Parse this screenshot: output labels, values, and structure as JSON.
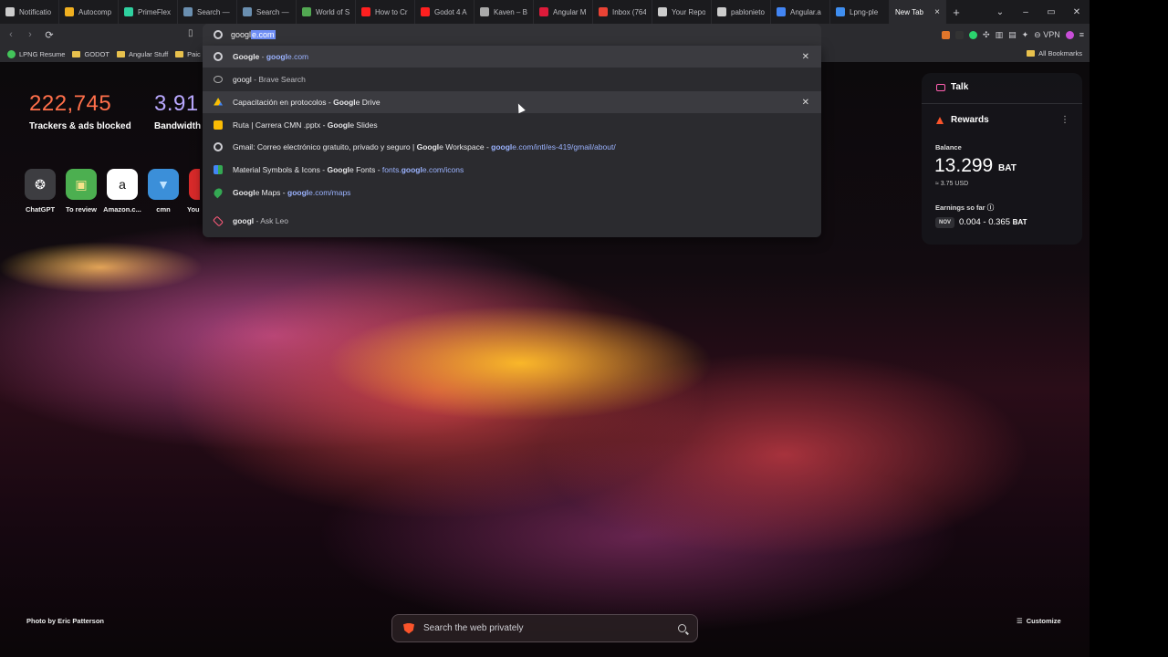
{
  "tabs": [
    {
      "label": "Notificatio",
      "color": "#cccccc"
    },
    {
      "label": "Autocomp",
      "color": "#f0b020"
    },
    {
      "label": "PrimeFlex",
      "color": "#2fd1a0"
    },
    {
      "label": "Search —",
      "color": "#6a8fb0"
    },
    {
      "label": "Search —",
      "color": "#6a8fb0"
    },
    {
      "label": "World of S",
      "color": "#52a852"
    },
    {
      "label": "How to Cr",
      "color": "#ff2020"
    },
    {
      "label": "Godot 4 A",
      "color": "#ff2020"
    },
    {
      "label": "Kaven – B",
      "color": "#aaaaaa"
    },
    {
      "label": "Angular M",
      "color": "#dd1b3a"
    },
    {
      "label": "Inbox (764",
      "color": "#ea4335"
    },
    {
      "label": "Your Repo",
      "color": "#cccccc"
    },
    {
      "label": "pablonieto",
      "color": "#cccccc"
    },
    {
      "label": "Angular.a",
      "color": "#4285f4"
    },
    {
      "label": "Lpng-ple",
      "color": "#3f8ef0"
    }
  ],
  "active_tab": {
    "label": "New Tab",
    "close": "×"
  },
  "new_tab_icon": "+",
  "window_controls": [
    "⌄",
    "–",
    "▭",
    "✕"
  ],
  "omnibox": {
    "typed": "googl",
    "completion": "e.com"
  },
  "extensions": {
    "vpn_label": "VPN"
  },
  "bookmarks": [
    "LPNG Resume",
    "GODOT",
    "Angular Stuff",
    "Paic"
  ],
  "all_bookmarks": "All Bookmarks",
  "suggestions": [
    {
      "parts": [
        {
          "t": "Google",
          "b": true
        },
        {
          "t": " - ",
          "c": "muted"
        },
        {
          "t": "googl",
          "c": "link",
          "b": true
        },
        {
          "t": "e.com",
          "c": "link"
        }
      ],
      "icon": "google-icon",
      "close": true,
      "highlight": true
    },
    {
      "parts": [
        {
          "t": "googl"
        },
        {
          "t": " - Brave Search",
          "c": "muted"
        }
      ],
      "icon": "search-icon",
      "close": false,
      "highlight": false
    },
    {
      "parts": [
        {
          "t": "Capacitación en protocolos - "
        },
        {
          "t": "Googl",
          "b": true
        },
        {
          "t": "e Drive"
        }
      ],
      "icon": "drive-icon",
      "close": true,
      "highlight": true
    },
    {
      "parts": [
        {
          "t": "Ruta | Carrera CMN .pptx - "
        },
        {
          "t": "Googl",
          "b": true
        },
        {
          "t": "e Slides"
        }
      ],
      "icon": "slides-icon",
      "close": false,
      "highlight": false
    },
    {
      "parts": [
        {
          "t": "Gmail: Correo electrónico gratuito, privado y seguro | "
        },
        {
          "t": "Googl",
          "b": true
        },
        {
          "t": "e Workspace - "
        },
        {
          "t": "googl",
          "c": "link",
          "b": true
        },
        {
          "t": "e.com/intl/es-419/gmail/about/",
          "c": "link"
        }
      ],
      "icon": "google-icon",
      "close": false,
      "highlight": false
    },
    {
      "parts": [
        {
          "t": "Material Symbols & Icons - "
        },
        {
          "t": "Googl",
          "b": true
        },
        {
          "t": "e Fonts - "
        },
        {
          "t": "fonts.",
          "c": "link"
        },
        {
          "t": "googl",
          "c": "link",
          "b": true
        },
        {
          "t": "e.com/icons",
          "c": "link"
        }
      ],
      "icon": "fonts-icon",
      "close": false,
      "highlight": false
    },
    {
      "parts": [
        {
          "t": "Googl",
          "b": true
        },
        {
          "t": "e Maps - "
        },
        {
          "t": "googl",
          "c": "link",
          "b": true
        },
        {
          "t": "e.com/maps",
          "c": "link"
        }
      ],
      "icon": "maps-icon",
      "close": false,
      "highlight": false
    },
    {
      "parts": [
        {
          "t": "googl",
          "b": true
        },
        {
          "t": " - Ask Leo",
          "c": "muted"
        }
      ],
      "icon": "leo-icon",
      "close": false,
      "highlight": false
    }
  ],
  "stats": {
    "trackers_value": "222,745",
    "trackers_label": "Trackers & ads blocked",
    "bandwidth_value": "3.91 G",
    "bandwidth_label": "Bandwidth",
    "trackers_color": "#ff6f4a",
    "bandwidth_color": "#b9a8ff"
  },
  "top_sites": [
    {
      "label": "ChatGPT",
      "glyph": "❂"
    },
    {
      "label": "To review",
      "glyph": "▣"
    },
    {
      "label": "Amazon.c...",
      "glyph": "a"
    },
    {
      "label": "cmn",
      "glyph": "▼"
    },
    {
      "label": "You",
      "glyph": "▶"
    }
  ],
  "widget": {
    "talk": "Talk",
    "rewards": "Rewards",
    "balance_label": "Balance",
    "balance_value": "13.299",
    "balance_unit": "BAT",
    "usd": "≈ 3.75 USD",
    "earnings_label": "Earnings so far",
    "month": "NOV",
    "earnings_range": "0.004 - 0.365",
    "earnings_unit": "BAT"
  },
  "photo_credit": "Photo by Eric Patterson",
  "customize": "Customize",
  "search_placeholder": "Search the web privately"
}
